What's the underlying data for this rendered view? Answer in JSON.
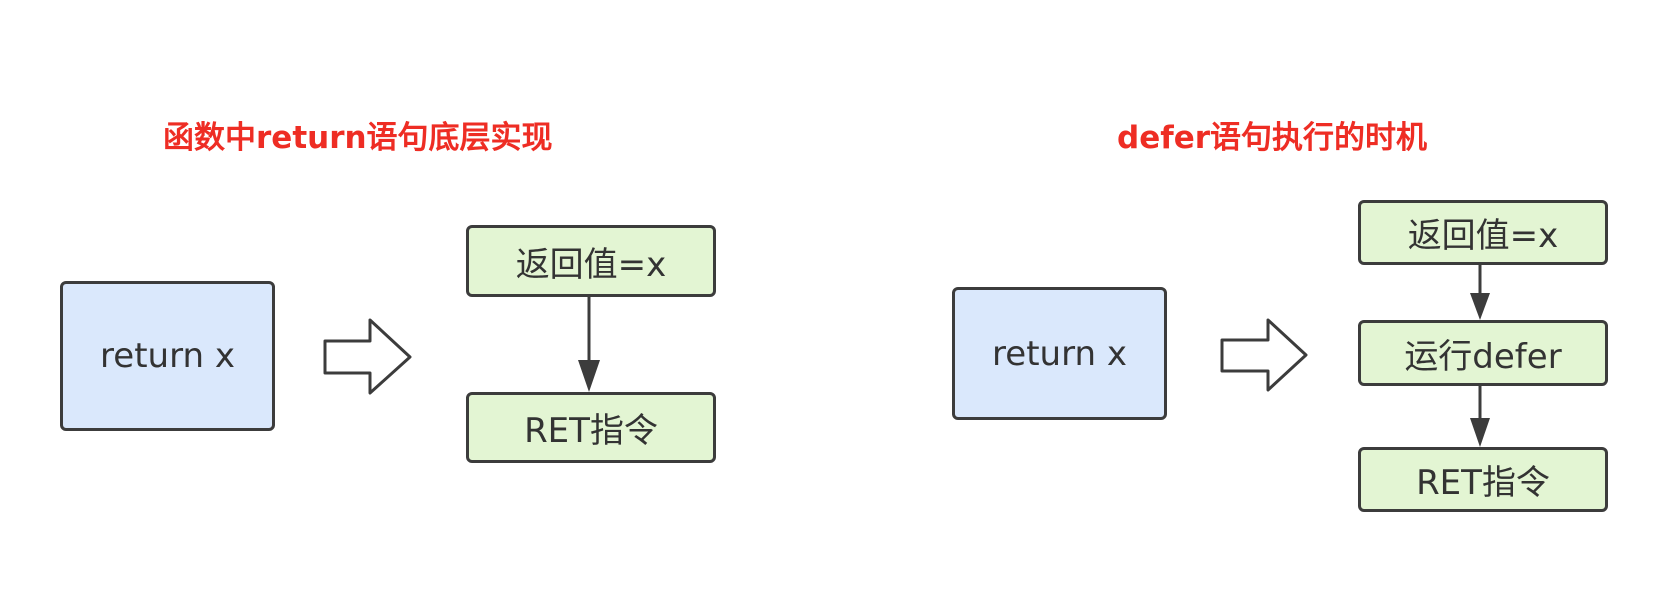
{
  "left": {
    "title": "函数中return语句底层实现",
    "source_label": "return x",
    "steps": [
      "返回值=x",
      "RET指令"
    ]
  },
  "right": {
    "title": "defer语句执行的时机",
    "source_label": "return x",
    "steps": [
      "返回值=x",
      "运行defer",
      "RET指令"
    ]
  },
  "colors": {
    "title": "#ee2d24",
    "source_fill": "#dae8fc",
    "step_fill": "#e3f5d3",
    "stroke": "#3c3c3c"
  }
}
